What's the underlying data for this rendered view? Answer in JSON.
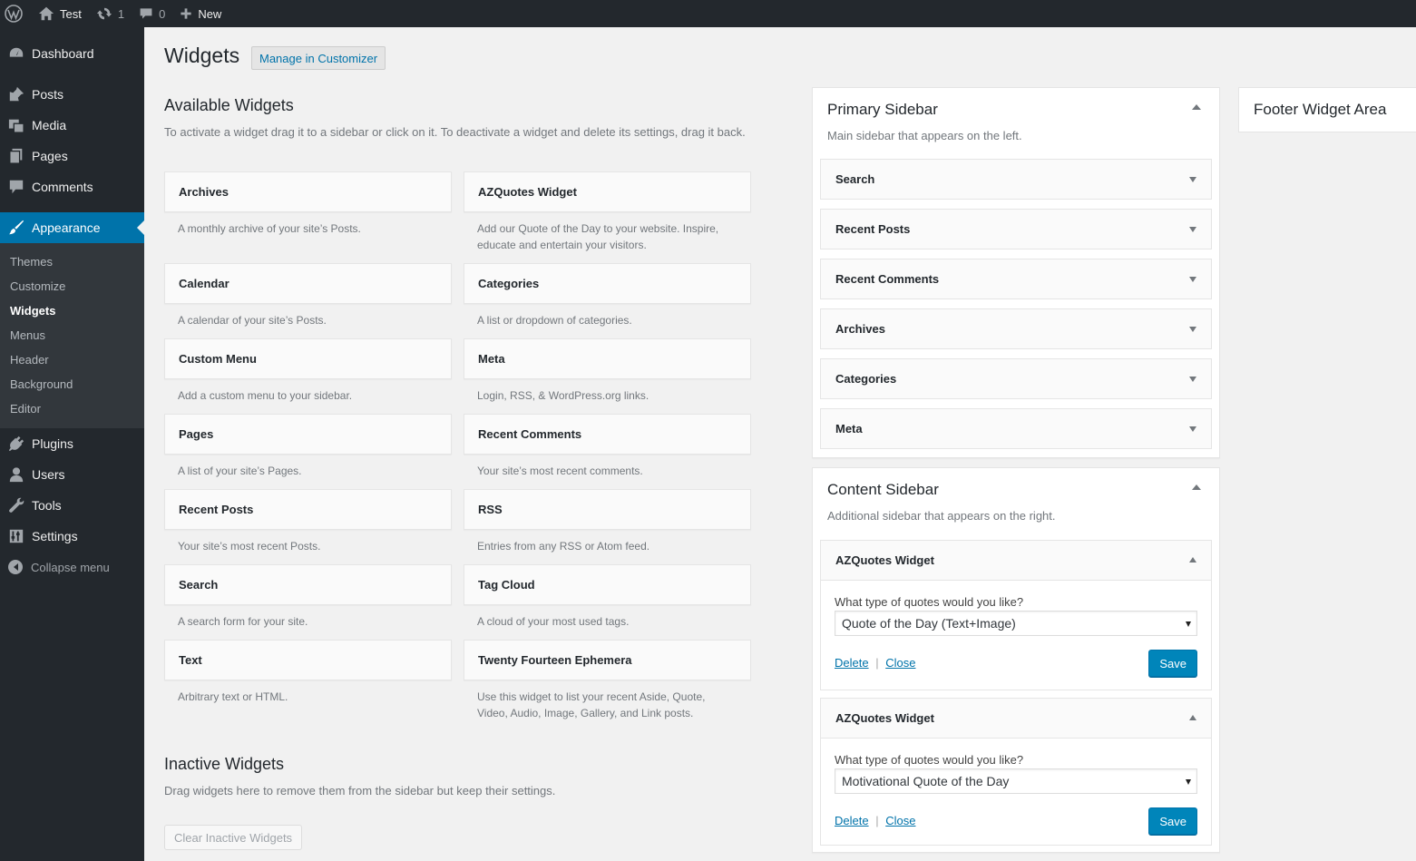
{
  "adminbar": {
    "site_name": "Test",
    "updates_count": "1",
    "comments_count": "0",
    "new_label": "New"
  },
  "menu": {
    "dashboard": "Dashboard",
    "posts": "Posts",
    "media": "Media",
    "pages": "Pages",
    "comments": "Comments",
    "appearance": "Appearance",
    "submenu": [
      "Themes",
      "Customize",
      "Widgets",
      "Menus",
      "Header",
      "Background",
      "Editor"
    ],
    "plugins": "Plugins",
    "users": "Users",
    "tools": "Tools",
    "settings": "Settings",
    "collapse": "Collapse menu"
  },
  "page": {
    "title": "Widgets",
    "action": "Manage in Customizer"
  },
  "available": {
    "heading": "Available Widgets",
    "description": "To activate a widget drag it to a sidebar or click on it. To deactivate a widget and delete its settings, drag it back.",
    "widgets": [
      {
        "title": "Archives",
        "desc": "A monthly archive of your site’s Posts."
      },
      {
        "title": "AZQuotes Widget",
        "desc": "Add our Quote of the Day to your website. Inspire, educate and entertain your visitors."
      },
      {
        "title": "Calendar",
        "desc": "A calendar of your site’s Posts."
      },
      {
        "title": "Categories",
        "desc": "A list or dropdown of categories."
      },
      {
        "title": "Custom Menu",
        "desc": "Add a custom menu to your sidebar."
      },
      {
        "title": "Meta",
        "desc": "Login, RSS, & WordPress.org links."
      },
      {
        "title": "Pages",
        "desc": "A list of your site’s Pages."
      },
      {
        "title": "Recent Comments",
        "desc": "Your site’s most recent comments."
      },
      {
        "title": "Recent Posts",
        "desc": "Your site’s most recent Posts."
      },
      {
        "title": "RSS",
        "desc": "Entries from any RSS or Atom feed."
      },
      {
        "title": "Search",
        "desc": "A search form for your site."
      },
      {
        "title": "Tag Cloud",
        "desc": "A cloud of your most used tags."
      },
      {
        "title": "Text",
        "desc": "Arbitrary text or HTML."
      },
      {
        "title": "Twenty Fourteen Ephemera",
        "desc": "Use this widget to list your recent Aside, Quote, Video, Audio, Image, Gallery, and Link posts."
      }
    ]
  },
  "inactive": {
    "heading": "Inactive Widgets",
    "description": "Drag widgets here to remove them from the sidebar but keep their settings.",
    "clear_button": "Clear Inactive Widgets"
  },
  "primary_sidebar": {
    "name": "Primary Sidebar",
    "description": "Main sidebar that appears on the left.",
    "widgets": [
      "Search",
      "Recent Posts",
      "Recent Comments",
      "Archives",
      "Categories",
      "Meta"
    ]
  },
  "content_sidebar": {
    "name": "Content Sidebar",
    "description": "Additional sidebar that appears on the right.",
    "widgets": [
      {
        "title": "AZQuotes Widget",
        "question": "What type of quotes would you like?",
        "selected": "Quote of the Day (Text+Image)",
        "delete": "Delete",
        "separator": "|",
        "close": "Close",
        "save": "Save"
      },
      {
        "title": "AZQuotes Widget",
        "question": "What type of quotes would you like?",
        "selected": "Motivational Quote of the Day",
        "delete": "Delete",
        "separator": "|",
        "close": "Close",
        "save": "Save"
      }
    ]
  },
  "footer_area": {
    "name": "Footer Widget Area"
  }
}
